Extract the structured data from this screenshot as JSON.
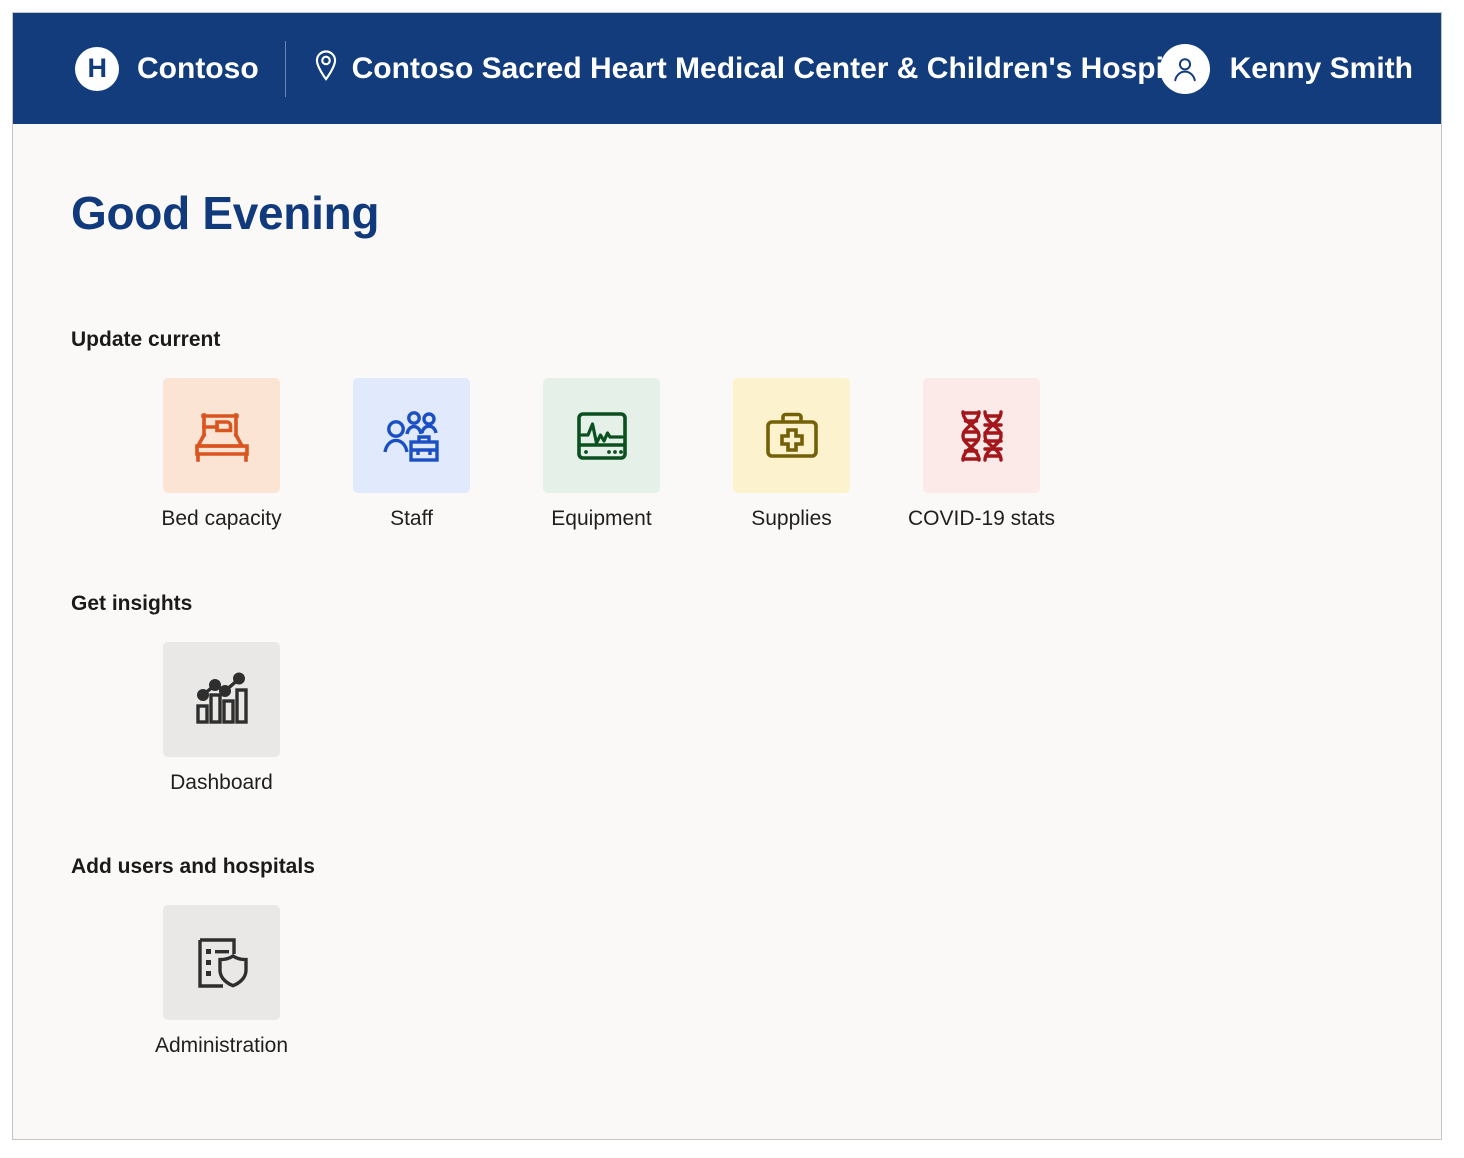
{
  "header": {
    "logo_letter": "H",
    "logo_icon": "hospital-logo-icon",
    "brand": "Contoso",
    "location_icon": "location-pin-icon",
    "site": "Contoso Sacred Heart Medical Center & Children's Hospital",
    "avatar_icon": "person-avatar-icon",
    "user": "Kenny Smith",
    "background_color": "#123c7c"
  },
  "main": {
    "greeting": "Good Evening",
    "greeting_color": "#113a7c",
    "background_color": "#faf9f8",
    "sections": [
      {
        "title": "Update current",
        "tiles": [
          {
            "label": "Bed capacity",
            "icon": "bed-icon",
            "tile_bg": "#fce4d4",
            "icon_color": "#d9541f"
          },
          {
            "label": "Staff",
            "icon": "people-briefcase-icon",
            "tile_bg": "#e1eafd",
            "icon_color": "#1b50c4"
          },
          {
            "label": "Equipment",
            "icon": "heart-monitor-icon",
            "tile_bg": "#e4f0e8",
            "icon_color": "#0b5120"
          },
          {
            "label": "Supplies",
            "icon": "first-aid-kit-icon",
            "tile_bg": "#fcf2cd",
            "icon_color": "#736007"
          },
          {
            "label": "COVID-19 stats",
            "icon": "dna-helix-icon",
            "tile_bg": "#fceae9",
            "icon_color": "#a4161a"
          }
        ]
      },
      {
        "title": "Get insights",
        "tiles": [
          {
            "label": "Dashboard",
            "icon": "bar-chart-icon",
            "tile_bg": "#e9e8e7",
            "icon_color": "#2e2e2e"
          }
        ]
      },
      {
        "title": "Add users and hospitals",
        "tiles": [
          {
            "label": "Administration",
            "icon": "document-shield-icon",
            "tile_bg": "#e9e8e7",
            "icon_color": "#2e2e2e"
          }
        ]
      }
    ]
  }
}
